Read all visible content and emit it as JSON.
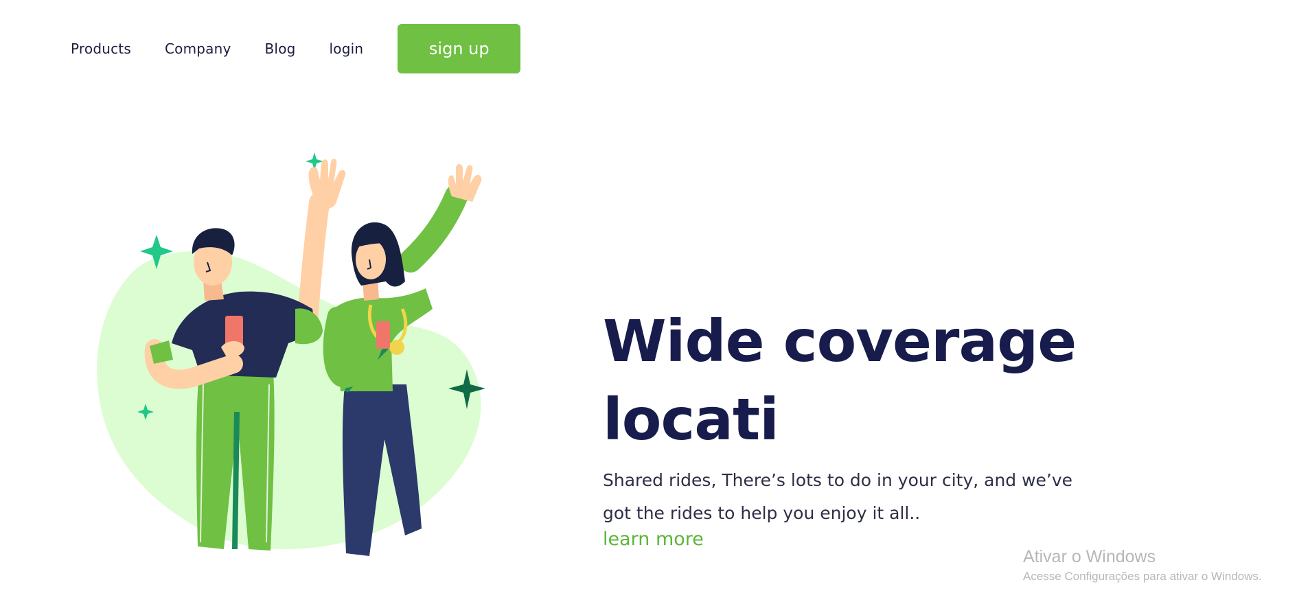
{
  "nav": {
    "links": [
      "Products",
      "Company",
      "Blog",
      "login"
    ],
    "signup_label": "sign up"
  },
  "hero": {
    "title_line1": "Wide coverage",
    "title_line2": "locati",
    "description": "Shared rides, There’s lots to do in your city, and we’ve got the rides to help you enjoy it all..",
    "cta_label": "learn more"
  },
  "watermark": {
    "title": "Ativar o Windows",
    "subtitle": "Acesse Configurações para ativar o Windows."
  },
  "colors": {
    "accent_green": "#6fc043",
    "title_navy": "#181c4c",
    "blob_green": "#dcfdd1"
  },
  "illustration": {
    "icon": "two-people-waving-illustration"
  }
}
